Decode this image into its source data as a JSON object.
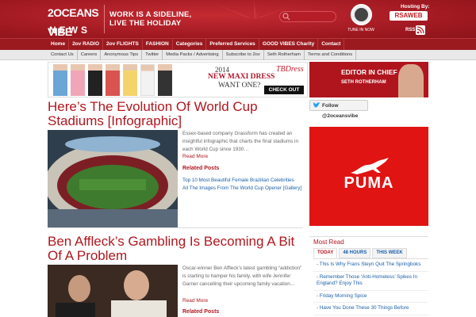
{
  "header": {
    "logo_top": "2OCEANS VIBE",
    "logo_bottom": "NEWS",
    "tagline_line1": "WORK IS A SIDELINE,",
    "tagline_line2": "LIVE THE HOLIDAY",
    "search_placeholder": "",
    "radio_label": "TUNE IN NOW",
    "hosting_label": "Hosting By:",
    "host_name": "RSAWEB",
    "rss_label": "RSS"
  },
  "main_nav": [
    "Home",
    "2ov RADIO",
    "2ov FLIGHTS",
    "FASHION",
    "Categories",
    "Preferred Services",
    "GOOD VIBES Charity",
    "Contact"
  ],
  "sub_nav": [
    "Contact Us",
    "Careers",
    "Anonymous Tips",
    "Twitter",
    "Media Packs / Advertising",
    "Subscribe to 2ov",
    "Seth Rotherham",
    "Terms and Conditions"
  ],
  "ads": {
    "dress_year": "2014",
    "dress_headline": "NEW MAXI DRESS",
    "dress_question": "WANT ONE?",
    "dress_brand": "TBDress",
    "dress_cta": "CHECK OUT NOW >>",
    "editor_title": "EDITOR IN CHIEF",
    "editor_name": "SETH ROTHERHAM"
  },
  "articles": [
    {
      "title": "Here’s The Evolution Of World Cup Stadiums [Infographic]",
      "excerpt": "Essex-based company Grassform has created an insightful infographic that charts the final stadiums in each World Cup since 1930…",
      "read_more": "Read More",
      "related_head": "Related Posts",
      "related": [
        "Top 10 Most Beautiful Female Brazilian Celebrities",
        "All The Images From The World Cup Opener [Gallery]"
      ]
    },
    {
      "title": "Ben Affleck’s Gambling Is Becoming A Bit Of A Problem",
      "excerpt": "Oscar-winner Ben Affleck’s latest gambling “addiction” is starting to hamper his family, with wife Jennifer Garner cancelling their upcoming family vacation…",
      "read_more": "Read More",
      "related_head": "Related Posts",
      "related": []
    }
  ],
  "sidebar": {
    "follow_label": "Follow @2oceansvibe",
    "puma_text": "PUMA",
    "most_read_title": "Most Read",
    "tabs": [
      "TODAY",
      "48 HOURS",
      "THIS WEEK"
    ],
    "most_read": [
      "- This Is Why Frans Steyn Quit The Springboks",
      "- Remember Those ‘Anti-Homeless’ Spikes In England? Enjoy This",
      "- Friday Morning Spice",
      "- Have You Done These 30 Things Before"
    ]
  },
  "colors": {
    "brand_red": "#b0171f",
    "link_blue": "#1b5fa8",
    "puma_red": "#e11414"
  }
}
